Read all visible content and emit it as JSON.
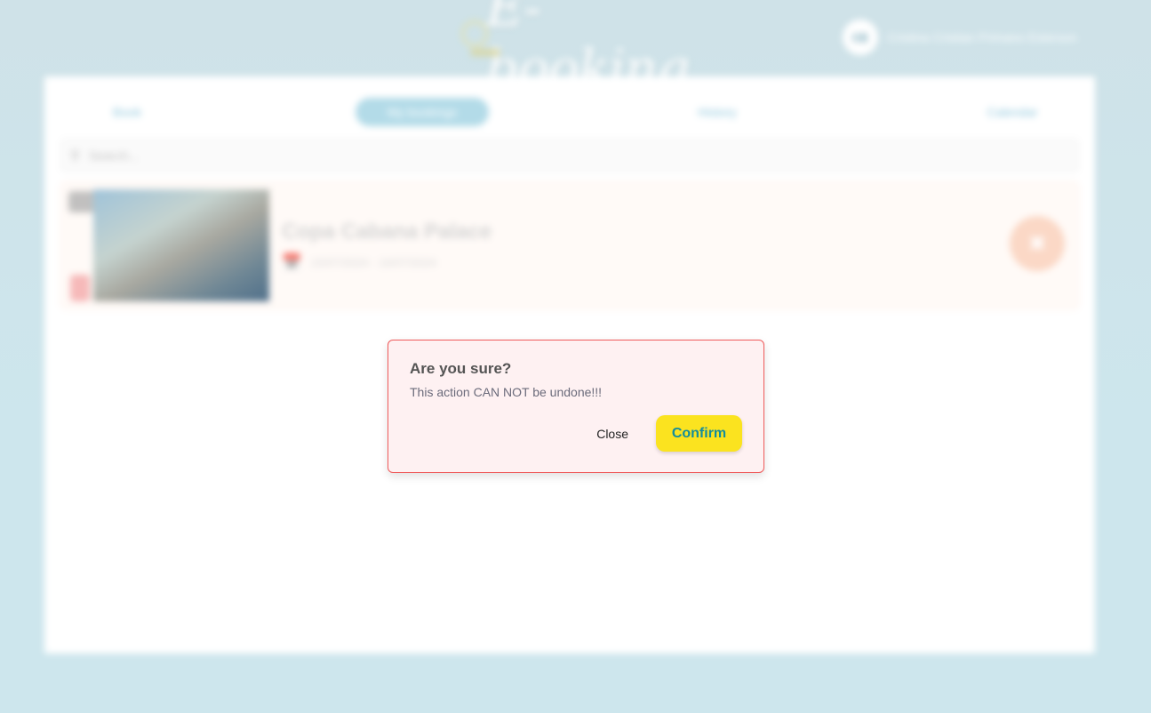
{
  "app": {
    "logo_text": "E-booking"
  },
  "user": {
    "initials": "CE",
    "name": "Cristina Cristian Primano Esterson"
  },
  "tabs": [
    {
      "label": "Book",
      "active": false
    },
    {
      "label": "My bookings",
      "active": true
    },
    {
      "label": "History",
      "active": false
    },
    {
      "label": "Calendar",
      "active": false
    }
  ],
  "search": {
    "placeholder": "Search..."
  },
  "booking": {
    "hotel_name": "Copa Cabana Palace",
    "dates": "15/07/2024 - 16/07/2024"
  },
  "dialog": {
    "title": "Are you sure?",
    "message": "This action CAN NOT be undone!!!",
    "close_label": "Close",
    "confirm_label": "Confirm"
  },
  "colors": {
    "confirm_bg": "#fbe31f",
    "confirm_text": "#138d9c",
    "dialog_border": "#ef5b5b",
    "dialog_bg": "#fef1f2",
    "active_tab": "#b3dbe8"
  }
}
